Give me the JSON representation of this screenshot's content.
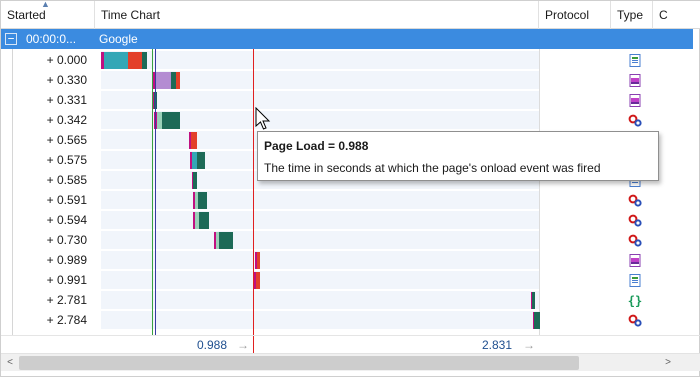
{
  "columns": {
    "started": "Started",
    "time_chart": "Time Chart",
    "protocol": "Protocol",
    "type": "Type",
    "extra": "C"
  },
  "group": {
    "expander": "−",
    "time": "00:00:0...",
    "label": "Google"
  },
  "rows": [
    {
      "started": "+ 0.000",
      "type_icon": "document-icon"
    },
    {
      "started": "+ 0.330",
      "type_icon": "image-icon"
    },
    {
      "started": "+ 0.331",
      "type_icon": "image-icon"
    },
    {
      "started": "+ 0.342",
      "type_icon": "gears-icon"
    },
    {
      "started": "+ 0.565",
      "type_icon": "gears-icon"
    },
    {
      "started": "+ 0.575",
      "type_icon": "gears-icon"
    },
    {
      "started": "+ 0.585",
      "type_icon": "document-icon"
    },
    {
      "started": "+ 0.591",
      "type_icon": "gears-icon"
    },
    {
      "started": "+ 0.594",
      "type_icon": "gears-icon"
    },
    {
      "started": "+ 0.730",
      "type_icon": "gears-icon"
    },
    {
      "started": "+ 0.989",
      "type_icon": "image-icon"
    },
    {
      "started": "+ 0.991",
      "type_icon": "document-icon"
    },
    {
      "started": "+ 2.781",
      "type_icon": "script-icon"
    },
    {
      "started": "+ 2.784",
      "type_icon": "gears-icon"
    }
  ],
  "scale": {
    "page_load": "0.988",
    "end": "2.831",
    "arrow": "→"
  },
  "tooltip": {
    "title": "Page Load = 0.988",
    "body": "The time in seconds at which the page's onload event was fired"
  },
  "scrollbar": {
    "left_arrow": "<",
    "right_arrow": ">"
  },
  "colors": {
    "selection": "#3b8be0",
    "page_load_line": "#e02020",
    "dom_line": "#3a3aa0",
    "green_line": "#3aa040"
  }
}
